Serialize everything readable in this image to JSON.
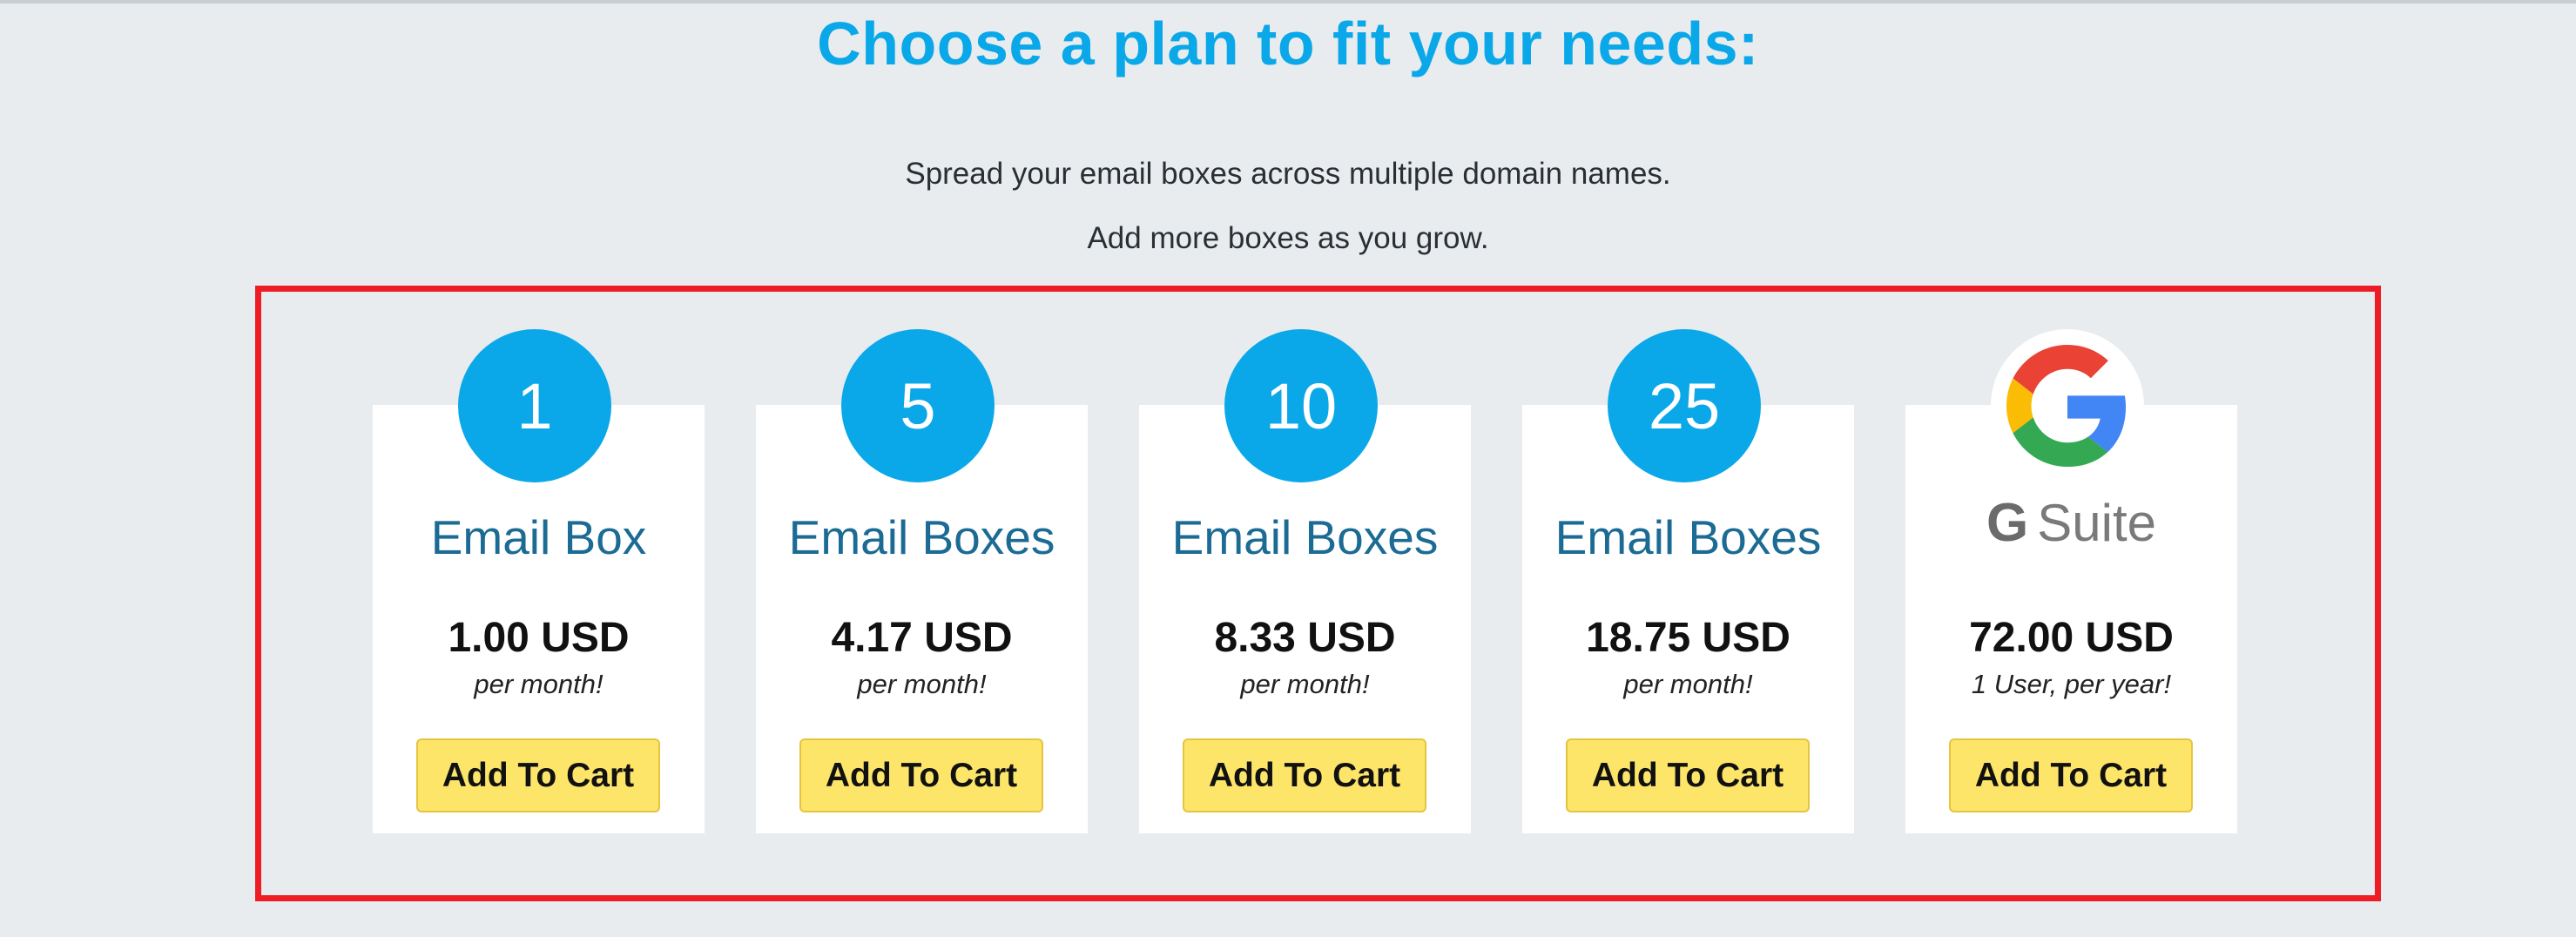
{
  "header": {
    "title": "Choose a plan to fit your needs:",
    "subtitle_line1": "Spread your email boxes across multiple domain names.",
    "subtitle_line2": "Add more boxes as you grow."
  },
  "plans": [
    {
      "count": "1",
      "label": "Email Box",
      "price": "1.00 USD",
      "period": "per month!",
      "button": "Add To Cart"
    },
    {
      "count": "5",
      "label": "Email Boxes",
      "price": "4.17 USD",
      "period": "per month!",
      "button": "Add To Cart"
    },
    {
      "count": "10",
      "label": "Email Boxes",
      "price": "8.33 USD",
      "period": "per month!",
      "button": "Add To Cart"
    },
    {
      "count": "25",
      "label": "Email Boxes",
      "price": "18.75 USD",
      "period": "per month!",
      "button": "Add To Cart"
    },
    {
      "logo": "google-g-icon",
      "brand_letter": "G",
      "brand_name": "Suite",
      "price": "72.00 USD",
      "period": "1 User, per year!",
      "button": "Add To Cart"
    }
  ],
  "colors": {
    "accent": "#0aa8e8",
    "label": "#1b6b94",
    "button": "#fde56a",
    "highlight": "#ee1c25",
    "background": "#e8ecef"
  }
}
